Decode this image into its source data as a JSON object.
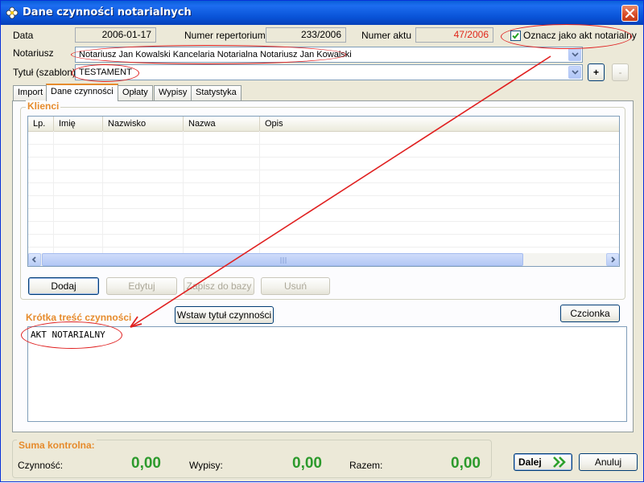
{
  "window": {
    "title": "Dane czynności notarialnych"
  },
  "header": {
    "data_label": "Data",
    "data_value": "2006-01-17",
    "repertorium_label": "Numer repertorium",
    "repertorium_value": "233/2006",
    "akt_label": "Numer aktu",
    "akt_value": "47/2006",
    "akt_checkbox_label": "Oznacz jako akt notarialny",
    "akt_checkbox_checked": true,
    "notariusz_label": "Notariusz",
    "notariusz_value": "Notariusz Jan Kowalski Kancelaria Notarialna Notariusz Jan Kowalski",
    "tytul_label": "Tytuł (szablon)",
    "tytul_value": "TESTAMENT",
    "add_label": "+",
    "remove_label": "-"
  },
  "tabs": [
    {
      "label": "Import",
      "active": false
    },
    {
      "label": "Dane czynności",
      "active": true
    },
    {
      "label": "Opłaty",
      "active": false
    },
    {
      "label": "Wypisy",
      "active": false
    },
    {
      "label": "Statystyka",
      "active": false
    }
  ],
  "klienci": {
    "title": "Klienci",
    "columns": [
      "Lp.",
      "Imię",
      "Nazwisko",
      "Nazwa",
      "Opis"
    ],
    "rows": [],
    "buttons": {
      "dodaj": "Dodaj",
      "edytuj": "Edytuj",
      "zapisz": "Zapisz do bazy",
      "usun": "Usuń"
    }
  },
  "tresc": {
    "title": "Krótka treść czynności",
    "insert_button": "Wstaw tytuł czynności",
    "font_button": "Czcionka",
    "text": "AKT NOTARIALNY"
  },
  "suma": {
    "title": "Suma kontrolna:",
    "czynnosc_label": "Czynność:",
    "czynnosc_value": "0,00",
    "wypisy_label": "Wypisy:",
    "wypisy_value": "0,00",
    "razem_label": "Razem:",
    "razem_value": "0,00"
  },
  "footer": {
    "dalej_label": "Dalej",
    "anuluj_label": "Anuluj"
  },
  "colors": {
    "titlebar": "#0a5fd8",
    "group_title": "#e68b2c",
    "sum_value": "#2c9a2c",
    "akt_number": "#e0261a",
    "annotation": "#e02020"
  },
  "icons": {
    "app": "flower-icon",
    "close": "close-icon",
    "dalej": "double-chevron-right-icon"
  }
}
